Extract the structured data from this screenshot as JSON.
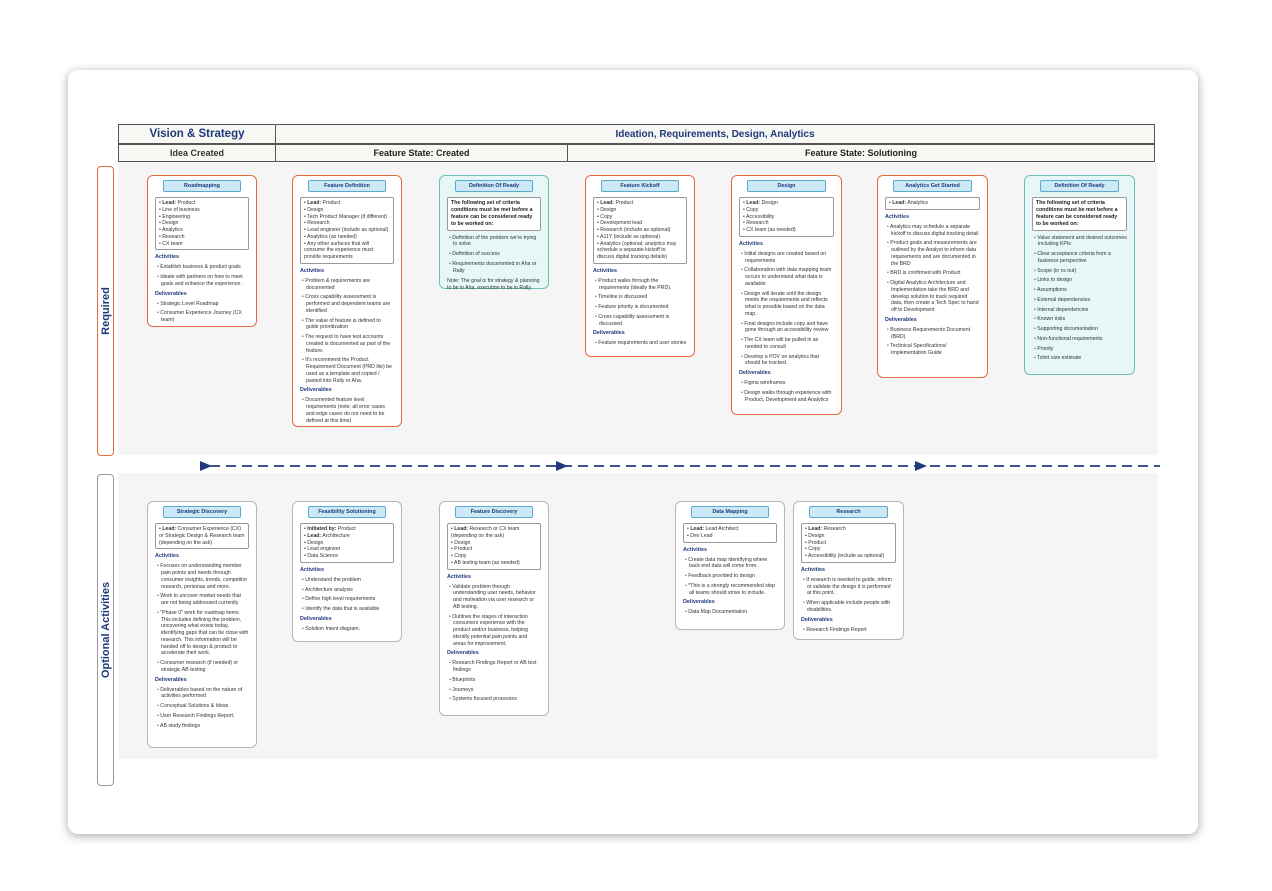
{
  "headers": {
    "phase1": "Vision & Strategy",
    "phase2": "Ideation, Requirements, Design, Analytics",
    "state1": "Idea Created",
    "state2": "Feature State: Created",
    "state3": "Feature State: Solutioning"
  },
  "row_labels": {
    "required": "Required",
    "optional": "Optional Activities"
  },
  "colors": {
    "required_border": "#e36b3c",
    "ready_fill": "#e6f7f5",
    "title_fill": "#cde9f6",
    "navy": "#1f3a7a"
  },
  "required": {
    "roadmapping": {
      "title": "Roadmapping",
      "leads": [
        "Lead: Product",
        "Line of business",
        "Engineering",
        "Design",
        "Analytics",
        "Research",
        "CX team"
      ],
      "activities_label": "Activities",
      "activities": [
        "Establish business & product goals",
        "Ideate with partners on how to meet goals and enhance the experience."
      ],
      "deliverables_label": "Deliverables",
      "deliverables": [
        "Strategic Level Roadmap",
        "Consumer Experience Journey (CX team)"
      ]
    },
    "feature_definition": {
      "title": "Feature Definition",
      "leads": [
        "Lead: Product",
        "Design",
        "Tech Product Manager (if different)",
        "Research",
        "Lead engineer (include as optional)",
        "Analytics (as needed)",
        "Any other surfaces that will consume the experience must provide requirements"
      ],
      "activities_label": "Activities",
      "activities": [
        "Problem & requirements are documented",
        "Cross capability assessment is performed and dependent teams are identified",
        "The value of feature is defined to guide prioritization",
        "The request to have test accounts created is documented as part of the feature.",
        "It's recommend the Product Requirement Document (PRD lite) be used as a template and copied / pasted into Rally or Aha."
      ],
      "deliverables_label": "Deliverables",
      "deliverables": [
        "Documented feature level requirements (note: all error cases and edge cases do not need to be defined at this time)"
      ]
    },
    "definition_ready_1": {
      "title": "Definition Of Ready",
      "intro": "The following set of criteria conditions must be met before a feature can be considered ready to be worked on:",
      "items": [
        "Definition of the problem we're trying to solve",
        "Definition of success",
        "Requirements documented in Aha or Rally"
      ],
      "note": "Note: The goal is for strategy & planning to be in Aha, execution to be in Rally."
    },
    "feature_kickoff": {
      "title": "Feature Kickoff",
      "leads": [
        "Lead: Product",
        "Design",
        "Copy",
        "Development lead",
        "Research (include as optional)",
        "A11Y (include as optional)",
        "Analytics (optional; analytics may schedule a separate kickoff to discuss digital tracking details)"
      ],
      "activities_label": "Activities",
      "activities": [
        "Product walks through the requirements (ideally the PRD).",
        "Timeline is discussed",
        "Feature priority is documented",
        "Cross capability assessment is discussed"
      ],
      "deliverables_label": "Deliverables",
      "deliverables": [
        "Feature requirements and user stories"
      ]
    },
    "design": {
      "title": "Design",
      "leads": [
        "Lead: Design",
        "Copy",
        "Accessibility",
        "Research",
        "CX team (as needed)"
      ],
      "activities_label": "Activities",
      "activities": [
        "Initial designs are created based on requirements",
        "Collaboration with data mapping team occurs to understand what data is available",
        "Design will iterate until the design meets the requirements and reflects what is possible based on the data map.",
        "Final designs include copy and have gone through an accessibility review",
        "The CX team will be pulled in as needed to consult",
        "Develop a POV on analytics that should be tracked."
      ],
      "deliverables_label": "Deliverables",
      "deliverables": [
        "Figma wireframes",
        "Design walks through experience with Product, Development and Analytics"
      ]
    },
    "analytics": {
      "title": "Analytics Get Started",
      "leads": [
        "Lead: Analytics"
      ],
      "activities_label": "Activities",
      "activities": [
        "Analytics may schedule a separate kickoff to discuss digital tracking detail",
        "Product goals and measurements are outlined by the Analyst to inform data requirements and are documented in the BRD",
        "BRD is confirmed with Product",
        "Digital Analytics Architecture and Implementation take the BRD and develop solution to track required data, then create a Tech Spec to hand off to Development"
      ],
      "deliverables_label": "Deliverables",
      "deliverables": [
        "Business Requirements Document (BRD)",
        "Technical Specifications/ Implementation Guide"
      ]
    },
    "definition_ready_2": {
      "title": "Definition Of Ready",
      "intro": "The following set of criteria conditions must be met before a feature can be considered ready to be worked on:",
      "items": [
        "Value statement and desired outcomes including KPIs",
        "Clear acceptance criteria from a business perspective",
        "Scope (in vs out)",
        "Links to design",
        "Assumptions",
        "External dependencies",
        "Internal dependencies",
        "Known risks",
        "Supporting documentation",
        "Non-functional requirements",
        "Priority",
        "Tshirt size estimate"
      ]
    }
  },
  "optional": {
    "strategic_discovery": {
      "title": "Strategic Discovery",
      "leads": [
        "Lead: Consumer Experience (CX) or Strategic Design & Research team (depending on the ask)"
      ],
      "activities_label": "Activities",
      "activities": [
        "Focuses on understanding member pain points and needs through consumer insights, trends, competitor research, personas and more.",
        "Work to uncover market needs that are not being addressed currently",
        "\"Phase 0\" work for roadmap items. This includes defining the problem, uncovering what exists today, identifying gaps that can be close with research. This information will be handed off to design & product to accelerate their work.",
        "Consumer research (if needed) or strategic AB testing"
      ],
      "deliverables_label": "Deliverables",
      "deliverables": [
        "Deliverables based on the nature of activities performed",
        "Conceptual Solutions & Ideas",
        "User Research Findings Report.",
        "AB study findings"
      ]
    },
    "feasibility": {
      "title": "Feasibility Solutioning",
      "leads": [
        "Initiated by: Product",
        "Lead: Architecture",
        "Design",
        "Lead engineer",
        "Data Science"
      ],
      "activities_label": "Activities",
      "activities": [
        "Understand the problem",
        "Architecture analysis",
        "Define high level requirements",
        "Identify the data that is available"
      ],
      "deliverables_label": "Deliverables",
      "deliverables": [
        "Solution Intent diagram."
      ]
    },
    "feature_discovery": {
      "title": "Feature Discovery",
      "leads": [
        "Lead: Research or CX team (depending on the ask)",
        "Design",
        "Product",
        "Copy",
        "AB testing team (as needed)"
      ],
      "activities_label": "Activities",
      "activities": [
        "Validate problem through understanding user needs, behavior and motivation via user research or AB testing.",
        "Outlines the stages of interaction consumers experience with the product and/or business, helping identify potential pain points and areas for improvement."
      ],
      "deliverables_label": "Deliverables",
      "deliverables": [
        "Research Findings Report or AB test findings",
        "Blueprints",
        "Journeys",
        "Systems focused processes"
      ]
    },
    "data_mapping": {
      "title": "Data Mapping",
      "leads": [
        "Lead: Lead Architect",
        "Dev Lead"
      ],
      "activities_label": "Activities",
      "activities": [
        "Create data map identifying where back end data will come from.",
        "Feedback provided to design",
        "*This is a strongly recommended step all teams should strive to include."
      ],
      "deliverables_label": "Deliverables",
      "deliverables": [
        "Data Map Documentation"
      ]
    },
    "research": {
      "title": "Research",
      "leads": [
        "Lead: Research",
        "Design",
        "Product",
        "Copy",
        "Accessibility (include as optional)"
      ],
      "activities_label": "Activities",
      "activities": [
        "If research is needed to guide, inform or validate the design it is performed at this point.",
        "When applicable include people with disabilities."
      ],
      "deliverables_label": "Deliverables",
      "deliverables": [
        "Research Findings Report"
      ]
    }
  }
}
